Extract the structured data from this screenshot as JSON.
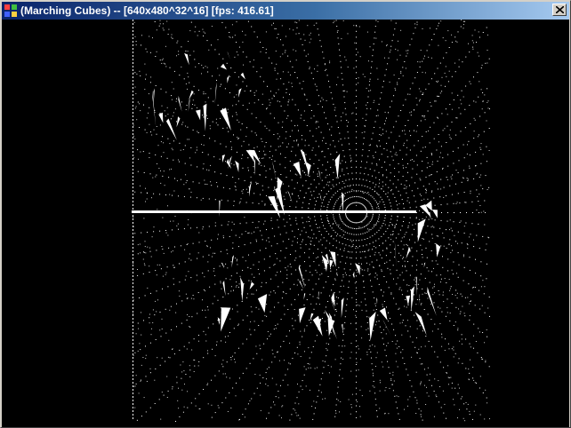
{
  "window": {
    "title": "(Marching Cubes) -- [640x480^32^16] [fps: 416.61]",
    "close_glyph": "✕"
  },
  "icons": {
    "app": "marching-cubes-app-icon",
    "close": "close-icon"
  },
  "colors": {
    "titlebar_start": "#0a246a",
    "titlebar_end": "#a6caf0",
    "viewport_bg": "#000000",
    "render_fg": "#ffffff"
  }
}
